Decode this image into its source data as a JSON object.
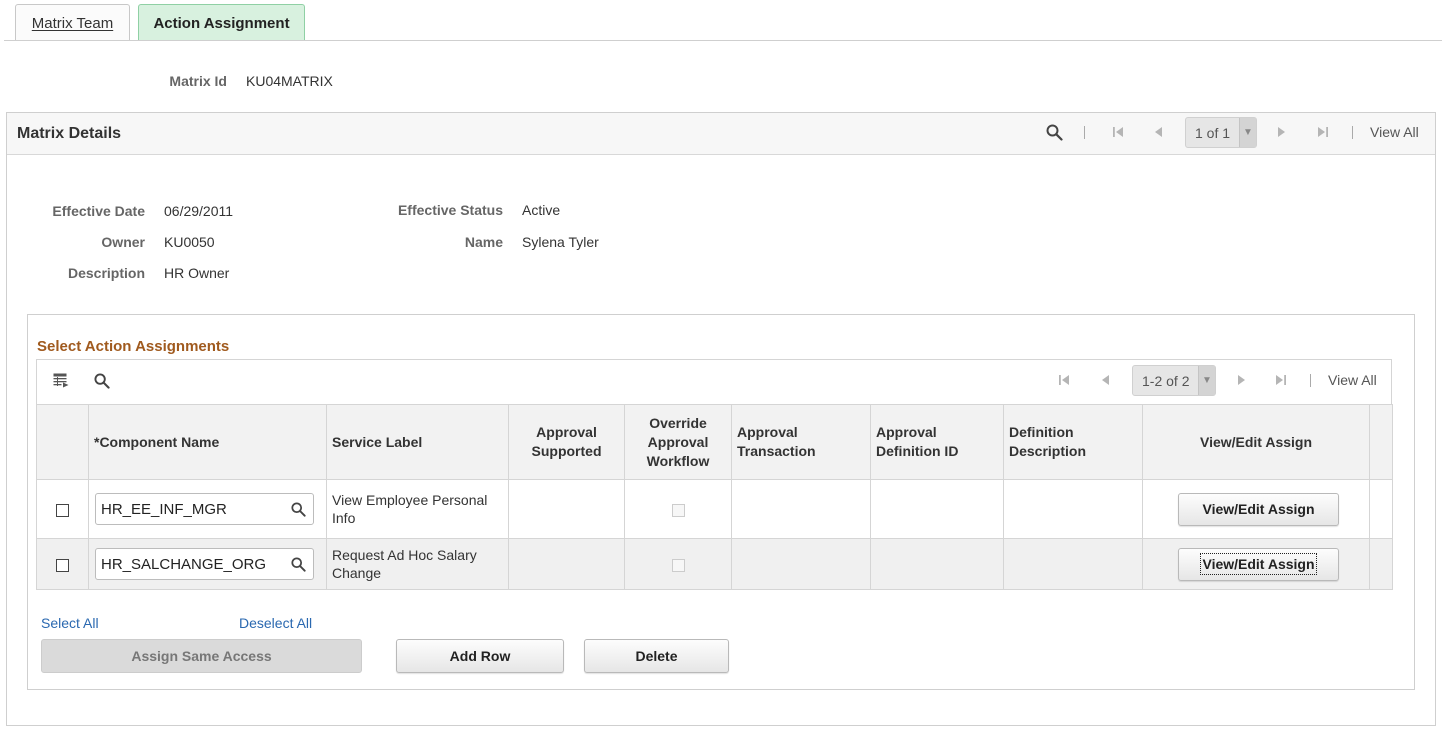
{
  "tabs": [
    {
      "label": "Matrix Team",
      "active": false
    },
    {
      "label": "Action Assignment",
      "active": true
    }
  ],
  "matrix": {
    "id_label": "Matrix Id",
    "id_value": "KU04MATRIX"
  },
  "details": {
    "title": "Matrix Details",
    "pager": "1 of 1",
    "view_all": "View All",
    "effective_date_label": "Effective Date",
    "effective_date": "06/29/2011",
    "effective_status_label": "Effective Status",
    "effective_status": "Active",
    "owner_label": "Owner",
    "owner": "KU0050",
    "name_label": "Name",
    "name": "Sylena Tyler",
    "description_label": "Description",
    "description": "HR Owner"
  },
  "assignments": {
    "title": "Select Action Assignments",
    "pager": "1-2 of 2",
    "view_all": "View All",
    "columns": {
      "component": "*Component Name",
      "service": "Service Label",
      "approval_supported_1": "Approval",
      "approval_supported_2": "Supported",
      "override_1": "Override",
      "override_2": "Approval",
      "override_3": "Workflow",
      "approval_txn_1": "Approval",
      "approval_txn_2": "Transaction",
      "approval_def_1": "Approval",
      "approval_def_2": "Definition ID",
      "def_desc_1": "Definition",
      "def_desc_2": "Description",
      "view_edit": "View/Edit Assign"
    },
    "rows": [
      {
        "component": "HR_EE_INF_MGR",
        "service_1": "View Employee Personal",
        "service_2": "Info",
        "button": "View/Edit Assign"
      },
      {
        "component": "HR_SALCHANGE_ORG",
        "service_1": "Request Ad Hoc Salary",
        "service_2": "Change",
        "button": "View/Edit Assign"
      }
    ],
    "select_all": "Select All",
    "deselect_all": "Deselect All",
    "assign_same_access": "Assign Same Access",
    "add_row": "Add Row",
    "delete": "Delete"
  },
  "colors": {
    "accent_tab": "#d8f1df",
    "section_title": "#a05a1e",
    "link": "#2a68b0"
  },
  "icons": [
    "search-icon",
    "first-page-icon",
    "previous-page-icon",
    "next-page-icon",
    "last-page-icon",
    "personalize-grid-icon",
    "prompt-lookup-icon"
  ]
}
